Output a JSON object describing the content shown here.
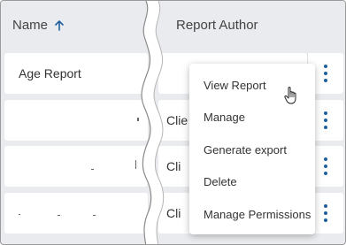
{
  "table": {
    "columns": {
      "name": "Name",
      "report_author": "Report Author"
    },
    "sort_icon": "arrow-up-icon",
    "rows": [
      {
        "name": "Age Report",
        "author": ""
      },
      {
        "name": "",
        "author": "Clie"
      },
      {
        "name": "",
        "author": "Cli"
      },
      {
        "name": "",
        "author": "Cli"
      }
    ]
  },
  "context_menu": {
    "items": [
      {
        "label": "View Report"
      },
      {
        "label": "Manage"
      },
      {
        "label": "Generate export"
      },
      {
        "label": "Delete"
      },
      {
        "label": "Manage Permissions"
      }
    ]
  },
  "colors": {
    "accent": "#1f5f9e",
    "header_bg": "#e9ebee",
    "row_bg": "#ffffff"
  },
  "icons": {
    "row_action": "kebab-menu-icon",
    "pointer": "hand-pointer-cursor-icon"
  }
}
